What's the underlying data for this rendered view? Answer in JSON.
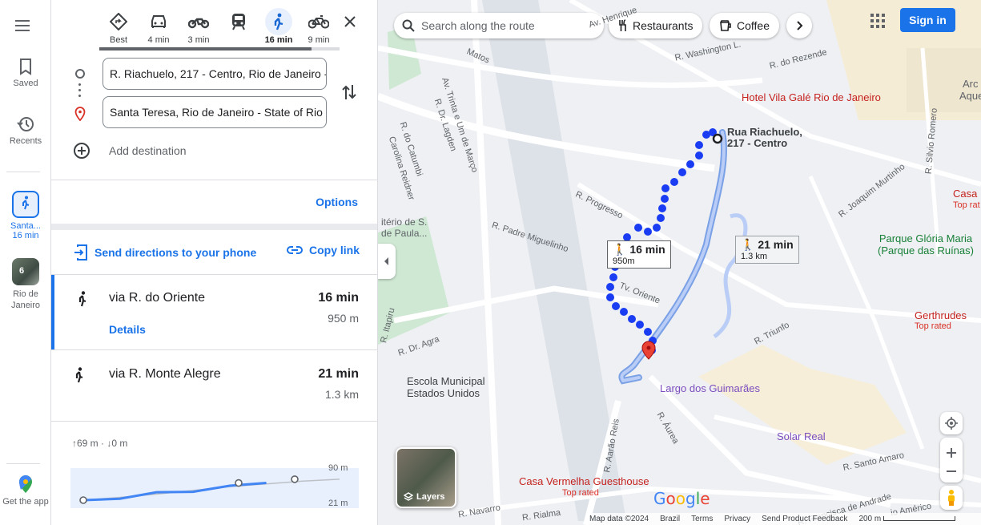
{
  "rail": {
    "saved": "Saved",
    "recents": "Recents",
    "active_trip": {
      "label": "Santa...",
      "time": "16 min"
    },
    "place": {
      "label": "Rio de Janeiro",
      "badge": "6"
    },
    "get_app": "Get the app"
  },
  "modes": [
    {
      "name": "Best",
      "icon": "diamond-route-icon"
    },
    {
      "name": "4 min",
      "icon": "car-icon"
    },
    {
      "name": "3 min",
      "icon": "motorcycle-icon"
    },
    {
      "name": "",
      "icon": "transit-icon"
    },
    {
      "name": "16 min",
      "icon": "walking-icon",
      "active": true
    },
    {
      "name": "9 min",
      "icon": "bicycle-icon"
    }
  ],
  "waypoints": {
    "origin": "R. Riachuelo, 217 - Centro, Rio de Janeiro - ",
    "destination": "Santa Teresa, Rio de Janeiro - State of Rio",
    "add_destination": "Add destination"
  },
  "options_label": "Options",
  "share": {
    "send": "Send directions to your phone",
    "copy": "Copy link"
  },
  "routes": [
    {
      "name": "via R. do Oriente",
      "time": "16 min",
      "distance": "950 m",
      "details": "Details",
      "selected": true
    },
    {
      "name": "via R. Monte Alegre",
      "time": "21 min",
      "distance": "1.3 km",
      "selected": false
    }
  ],
  "elevation": {
    "summary": "↑69 m · ↓0 m",
    "max_label": "90 m",
    "min_label": "21 m",
    "selected_profile": [
      21,
      24,
      38,
      39,
      52,
      58,
      58,
      58
    ],
    "alt_profile": [
      21,
      27,
      34,
      42,
      50,
      56,
      62,
      66
    ]
  },
  "map": {
    "search_placeholder": "Search along the route",
    "chips": [
      "Restaurants",
      "Coffee"
    ],
    "sign_in": "Sign in",
    "streets": [
      "Av. Henrique",
      "R. Washington L.",
      "R. do Rezende",
      "Arc",
      "Aqued",
      "R. Silvio Romero",
      "Av. Trinta e Um de Março",
      "R. Dr. Lagden",
      "R. do Catumbi",
      "Carolina Reidner",
      "R. Progresso",
      "R. Padre Miguelinho",
      "R. Joaquim Murtinho",
      "Tv. Oriente",
      "R. Triunfo",
      "R. Itapiru",
      "R. Dr. Agra",
      "R. Aarão Reis",
      "R. Áurea",
      "R. Santo Amaro",
      "R. Navarro",
      "R. Rialma",
      "R. Francisca de Andrade",
      "io Américo",
      "Matos",
      "itério de S.",
      "de Paula..."
    ],
    "pois": {
      "origin": "Rua Riachuelo, 217 - Centro",
      "hotel": "Hotel Vila Galé Rio de Janeiro",
      "casa": "Casa Hous",
      "casa_rated": "Top rat",
      "park": "Parque Glória Maria (Parque das Ruínas)",
      "gerthrudes": "Gerthrudes",
      "gerthrudes_rated": "Top rated",
      "school": "Escola Municipal Estados Unidos",
      "largo": "Largo dos Guimarães",
      "solar": "Solar Real",
      "casa_vermelha": "Casa Vermelha Guesthouse",
      "casa_vermelha_rated": "Top rated"
    },
    "badge_selected": {
      "time": "16 min",
      "dist": "950m"
    },
    "badge_alt": {
      "time": "21 min",
      "dist": "1.3 km"
    },
    "layers": "Layers",
    "google": "Google",
    "footer": [
      "Map data ©2024",
      "Brazil",
      "Terms",
      "Privacy",
      "Send Product Feedback",
      "200 m"
    ]
  }
}
